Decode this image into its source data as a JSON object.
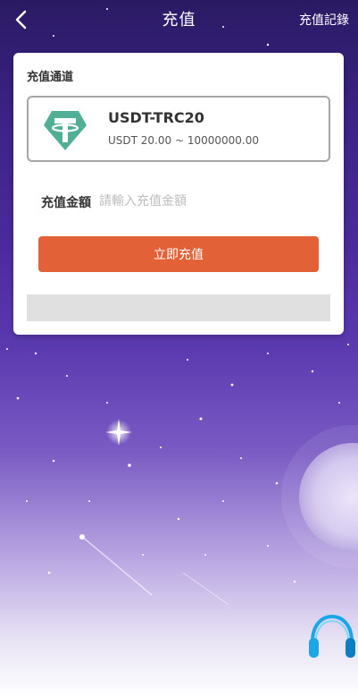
{
  "header": {
    "title": "充值",
    "records_label": "充值記錄"
  },
  "card": {
    "section_label": "充值通道",
    "channel": {
      "name": "USDT-TRC20",
      "range": "USDT 20.00 ~ 10000000.00",
      "icon": "tether-icon",
      "icon_color": "#50af95"
    },
    "amount_label": "充值金額",
    "amount_placeholder": "請輸入充值金額",
    "amount_value": "",
    "submit_label": "立即充值",
    "submit_color": "#e26136"
  },
  "support": {
    "icon": "headset-icon",
    "color": "#1aa7e8"
  }
}
